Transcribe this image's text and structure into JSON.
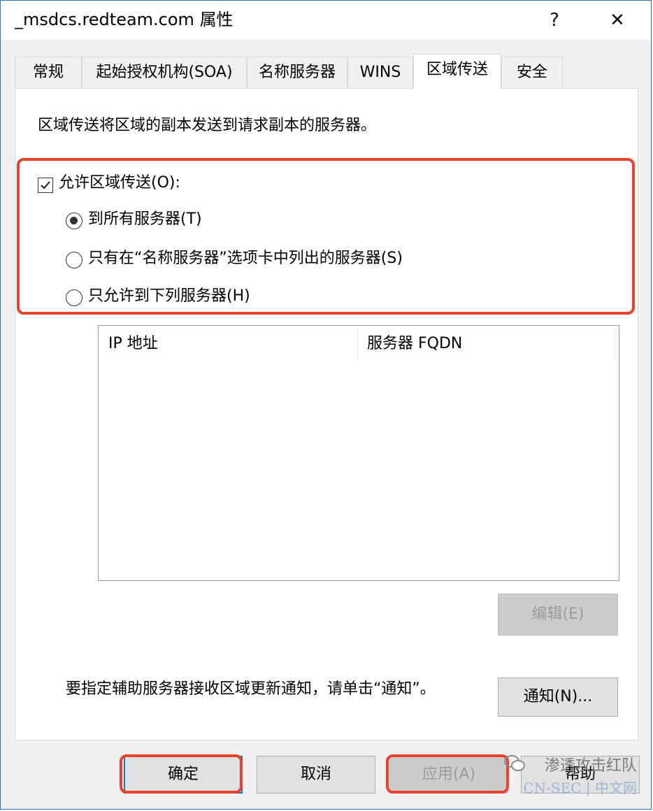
{
  "window": {
    "title": "_msdcs.redteam.com 属性",
    "help_glyph": "?",
    "close_glyph": "✕"
  },
  "tabs": [
    {
      "label": "常规"
    },
    {
      "label": "起始授权机构(SOA)"
    },
    {
      "label": "名称服务器"
    },
    {
      "label": "WINS"
    },
    {
      "label": "区域传送",
      "active": true
    },
    {
      "label": "安全"
    }
  ],
  "panel": {
    "description": "区域传送将区域的副本发送到请求副本的服务器。",
    "allow_transfer": {
      "label": "允许区域传送(O):",
      "checked": true
    },
    "options": [
      {
        "label": "到所有服务器(T)",
        "selected": true
      },
      {
        "label": "只有在“名称服务器”选项卡中列出的服务器(S)",
        "selected": false
      },
      {
        "label": "只允许到下列服务器(H)",
        "selected": false
      }
    ],
    "list_columns": [
      "IP 地址",
      "服务器 FQDN"
    ],
    "edit_button": "编辑(E)",
    "notify_text": "要指定辅助服务器接收区域更新通知，请单击“通知”。",
    "notify_button": "通知(N)..."
  },
  "footer": {
    "ok": "确定",
    "cancel": "取消",
    "apply": "应用(A)",
    "help": "帮助"
  },
  "watermark": {
    "line1": "渗透攻击红队",
    "line2": "CN-SEC | 中文网"
  },
  "colors": {
    "highlight_red": "#e8412c",
    "accent_blue": "#0078d7"
  }
}
